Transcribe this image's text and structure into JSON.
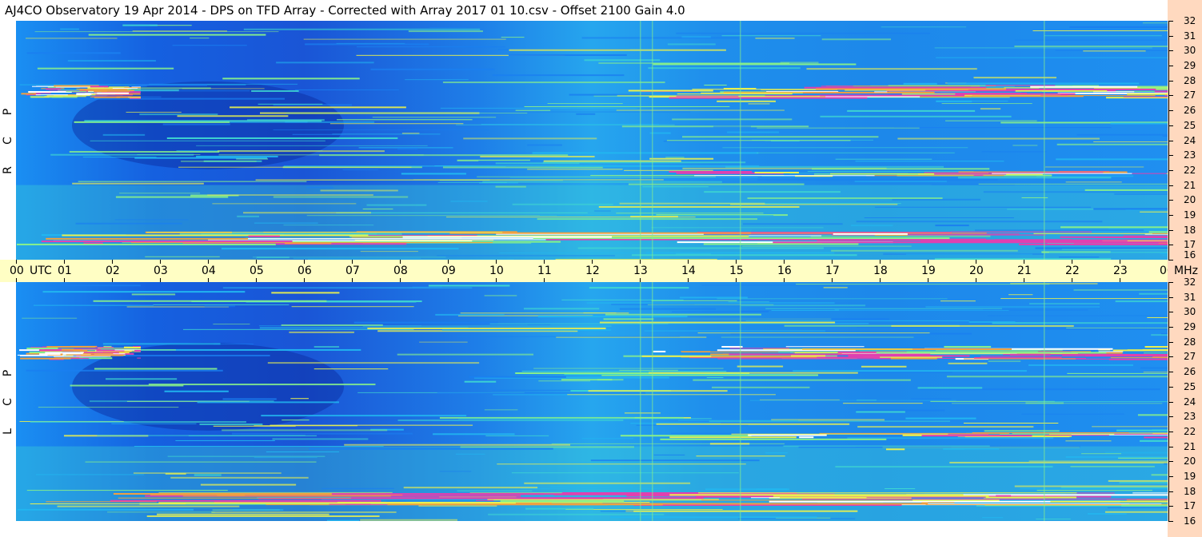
{
  "title": "AJ4CO Observatory  19 Apr 2014  -  DPS on TFD Array  -  Corrected with Array 2017 01 10.csv  -  Offset 2100  Gain 4.0",
  "panels": [
    {
      "id": "rcp",
      "letters": [
        "R",
        "C",
        "P"
      ]
    },
    {
      "id": "lcp",
      "letters": [
        "L",
        "C",
        "P"
      ]
    }
  ],
  "time_axis": {
    "labels": [
      "00",
      "01",
      "02",
      "03",
      "04",
      "05",
      "06",
      "07",
      "08",
      "09",
      "10",
      "11",
      "12",
      "13",
      "14",
      "15",
      "16",
      "17",
      "18",
      "19",
      "20",
      "21",
      "22",
      "23",
      "00"
    ],
    "utc_label": "UTC",
    "unit_label": "MHz"
  },
  "freq_axis": {
    "labels": [
      "32",
      "31",
      "30",
      "29",
      "28",
      "27",
      "26",
      "25",
      "24",
      "23",
      "22",
      "21",
      "20",
      "19",
      "18",
      "17",
      "16"
    ],
    "range": [
      16,
      32
    ]
  },
  "colors": {
    "title_bg": "#ffffff",
    "utc_bar_bg": "#fffec4",
    "freq_axis_bg": "#ffd9bf",
    "colormap": [
      "#0a2a9e",
      "#1050d8",
      "#1a7ff0",
      "#22b7f0",
      "#3fd7d0",
      "#88f08a",
      "#e8f050",
      "#f0a040",
      "#e040b0",
      "#ffffff"
    ]
  },
  "chart_data": [
    {
      "type": "heatmap",
      "title": "AJ4CO Observatory  19 Apr 2014  -  DPS on TFD Array  -  Corrected with Array 2017 01 10.csv  -  Offset 2100  Gain 4.0",
      "panel": "RCP",
      "x_range_utc_hours": [
        0,
        24
      ],
      "y_range_mhz": [
        16,
        32
      ],
      "bands": [
        {
          "freq_mhz": 27.3,
          "intensity": "high",
          "utc_hours": [
            [
              0,
              2.6
            ],
            [
              12.3,
              24
            ]
          ]
        },
        {
          "freq_mhz": 17.5,
          "intensity": "high",
          "utc_hours": [
            [
              0,
              24
            ]
          ]
        },
        {
          "freq_mhz": 21.8,
          "intensity": "medium",
          "utc_hours": [
            [
              12.5,
              24
            ]
          ]
        }
      ],
      "colorbar": "none"
    },
    {
      "type": "heatmap",
      "panel": "LCP",
      "x_range_utc_hours": [
        0,
        24
      ],
      "y_range_mhz": [
        16,
        32
      ],
      "bands": [
        {
          "freq_mhz": 27.3,
          "intensity": "high",
          "utc_hours": [
            [
              0,
              2.6
            ],
            [
              12.3,
              24
            ]
          ]
        },
        {
          "freq_mhz": 17.5,
          "intensity": "high",
          "utc_hours": [
            [
              0,
              24
            ]
          ]
        },
        {
          "freq_mhz": 21.8,
          "intensity": "medium",
          "utc_hours": [
            [
              12.5,
              24
            ]
          ]
        }
      ],
      "colorbar": "none"
    }
  ]
}
